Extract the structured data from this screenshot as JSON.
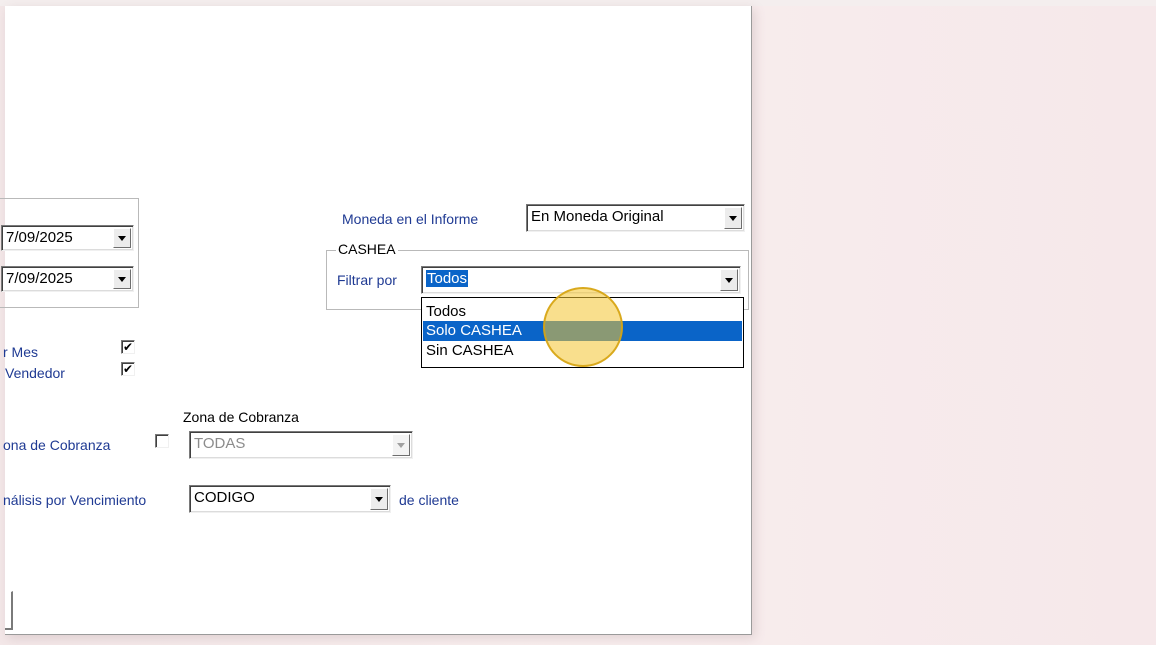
{
  "report": {
    "date_from": "7/09/2025",
    "date_to": "7/09/2025",
    "moneda_label": "Moneda en el Informe",
    "moneda_value": "En Moneda Original",
    "cashea_group": "CASHEA",
    "filtrar_label": "Filtrar por",
    "filtrar_value": "Todos",
    "filtrar_options": [
      "Todos",
      "Solo CASHEA",
      "Sin CASHEA"
    ],
    "filtrar_highlighted": "Solo CASHEA",
    "check_mes_label": "r Mes",
    "check_mes_checked": true,
    "check_vendedor_label": "Vendedor",
    "check_vendedor_checked": true,
    "zona_title": "Zona de Cobranza",
    "zona_check_label": "ona de Cobranza",
    "zona_check_checked": false,
    "zona_value": "TODAS",
    "analisis_label": "nálisis por Vencimiento",
    "analisis_value": "CODIGO",
    "analisis_suffix": "de cliente"
  },
  "icons": {
    "dropdown": "chevron-down-icon",
    "check": "checkmark-icon"
  },
  "colors": {
    "selection": "#0a64c8",
    "label_blue": "#1f3a93",
    "cursor_highlight": "#f4c430"
  }
}
